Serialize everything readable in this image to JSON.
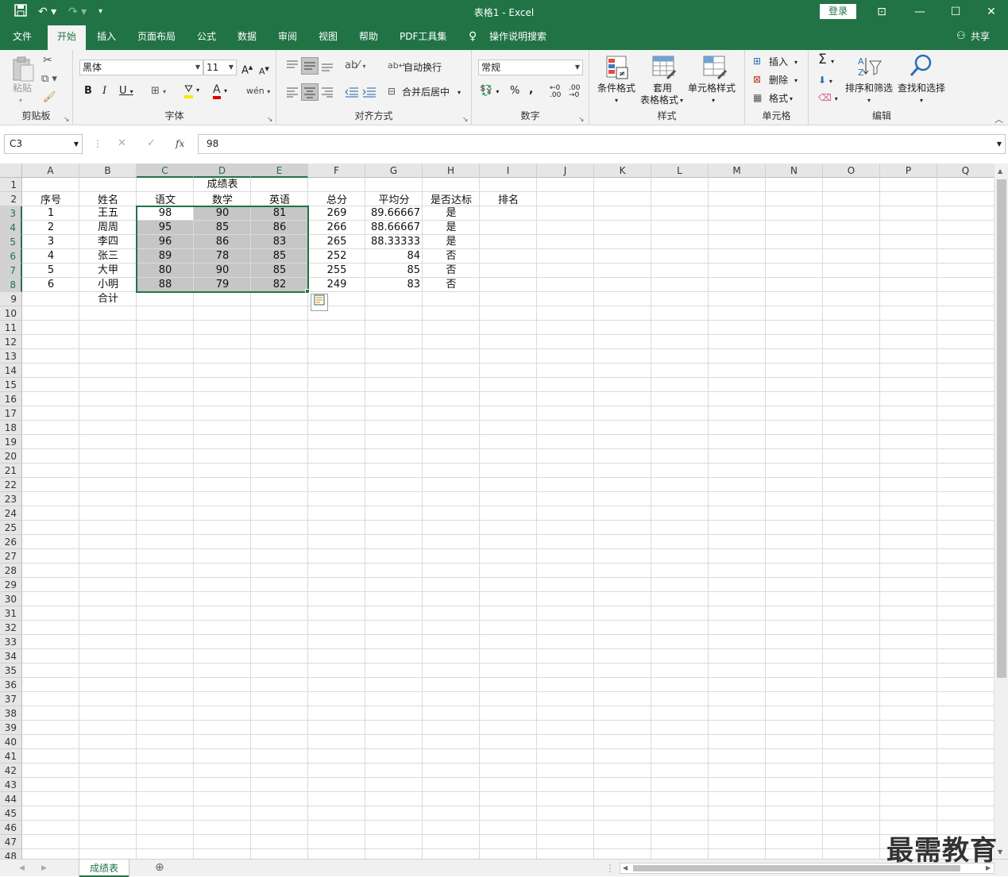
{
  "titlebar": {
    "title": "表格1  -  Excel",
    "login": "登录"
  },
  "tabs": [
    "文件",
    "开始",
    "插入",
    "页面布局",
    "公式",
    "数据",
    "审阅",
    "视图",
    "帮助",
    "PDF工具集"
  ],
  "tell_me": "操作说明搜索",
  "share": "共享",
  "ribbon": {
    "clipboard": {
      "label": "剪贴板",
      "paste": "粘贴"
    },
    "font": {
      "label": "字体",
      "name": "黑体",
      "size": "11"
    },
    "align": {
      "label": "对齐方式",
      "wrap": "自动换行",
      "merge": "合并后居中"
    },
    "number": {
      "label": "数字",
      "format": "常规"
    },
    "styles": {
      "label": "样式",
      "cond": "条件格式",
      "table1": "套用",
      "table2": "表格格式",
      "cell": "单元格样式"
    },
    "cells": {
      "label": "单元格",
      "insert": "插入",
      "delete": "删除",
      "format": "格式"
    },
    "edit": {
      "label": "编辑",
      "sort": "排序和筛选",
      "find": "查找和选择"
    }
  },
  "formula_bar": {
    "namebox": "C3",
    "value": "98"
  },
  "columns": [
    "A",
    "B",
    "C",
    "D",
    "E",
    "F",
    "G",
    "H",
    "I",
    "J",
    "K",
    "L",
    "M",
    "N",
    "O",
    "P",
    "Q"
  ],
  "sheet": {
    "title": "成绩表",
    "headers": [
      "序号",
      "姓名",
      "语文",
      "数学",
      "英语",
      "总分",
      "平均分",
      "是否达标",
      "排名"
    ],
    "rows": [
      [
        "1",
        "王五",
        "98",
        "90",
        "81",
        "269",
        "89.66667",
        "是"
      ],
      [
        "2",
        "周周",
        "95",
        "85",
        "86",
        "266",
        "88.66667",
        "是"
      ],
      [
        "3",
        "李四",
        "96",
        "86",
        "83",
        "265",
        "88.33333",
        "是"
      ],
      [
        "4",
        "张三",
        "89",
        "78",
        "85",
        "252",
        "84",
        "否"
      ],
      [
        "5",
        "大甲",
        "80",
        "90",
        "85",
        "255",
        "85",
        "否"
      ],
      [
        "6",
        "小明",
        "88",
        "79",
        "82",
        "249",
        "83",
        "否"
      ]
    ],
    "total_label": "合计"
  },
  "sheet_tab": "成绩表",
  "watermark": "最需教育",
  "colors": {
    "accent": "#217346",
    "selection": "#c6c6c6"
  }
}
